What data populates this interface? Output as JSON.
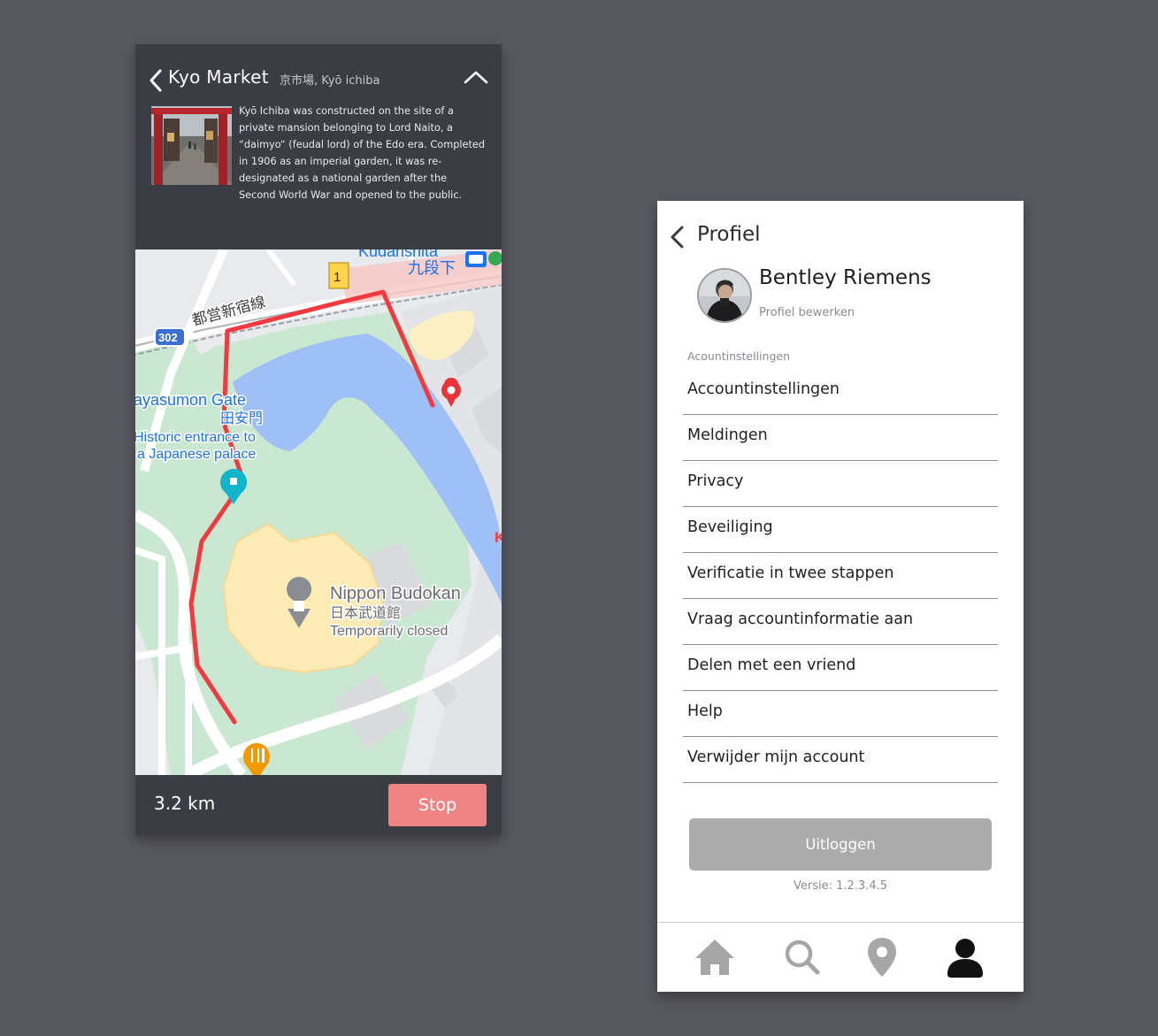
{
  "navigation": {
    "place_title": "Kyo Market",
    "place_subtitle": "京市場, Kyō ichiba",
    "description": "Kyō Ichiba was constructed on the site of a private mansion belonging to Lord Naito, a “daimyo“ (feudal lord) of the Edo era. Completed in 1906 as an imperial garden, it was re-designated as a national garden after the Second World War and opened to the public.",
    "distance": "3.2 km",
    "stop_label": "Stop",
    "map": {
      "station_label": "Kudanshita",
      "station_label_jp": "九段下",
      "exit_badge": "1",
      "rail_label": "都営新宿線",
      "road_badge": "302",
      "gate_label": "ayasumon Gate",
      "gate_label_jp": "田安門",
      "gate_note_1": "Historic entrance to",
      "gate_note_2": "a Japanese palace",
      "venue_label": "Nippon Budokan",
      "venue_label_jp": "日本武道館",
      "venue_status": "Temporarily closed",
      "edge_letter": "K"
    },
    "colors": {
      "panel": "#3b3d45",
      "route": "#f03a3f",
      "stop_button": "#ee8584"
    },
    "icons": [
      "chevron-left-icon",
      "chevron-up-icon",
      "map-pin-icon",
      "restaurant-pin-icon",
      "sightseeing-pin-icon",
      "landmark-pin-icon"
    ]
  },
  "profile": {
    "title": "Profiel",
    "user_name": "Bentley Riemens",
    "edit_link": "Profiel bewerken",
    "section_heading": "Acountinstellingen",
    "settings_items": [
      {
        "label": "Accountinstellingen"
      },
      {
        "label": "Meldingen"
      },
      {
        "label": "Privacy"
      },
      {
        "label": "Beveiliging"
      },
      {
        "label": "Verificatie in twee stappen"
      },
      {
        "label": "Vraag accountinformatie aan"
      },
      {
        "label": "Delen met een vriend"
      },
      {
        "label": "Help"
      },
      {
        "label": "Verwijder mijn account"
      }
    ],
    "logout_label": "Uitloggen",
    "version": "Versie: 1.2.3.4.5",
    "tabs": [
      {
        "icon": "home-icon",
        "active": false
      },
      {
        "icon": "search-icon",
        "active": false
      },
      {
        "icon": "location-pin-icon",
        "active": false
      },
      {
        "icon": "user-icon",
        "active": true
      }
    ],
    "colors": {
      "active_tab": "#111111",
      "inactive_tab": "#a6a6a6",
      "logout_button": "#ababab"
    }
  }
}
